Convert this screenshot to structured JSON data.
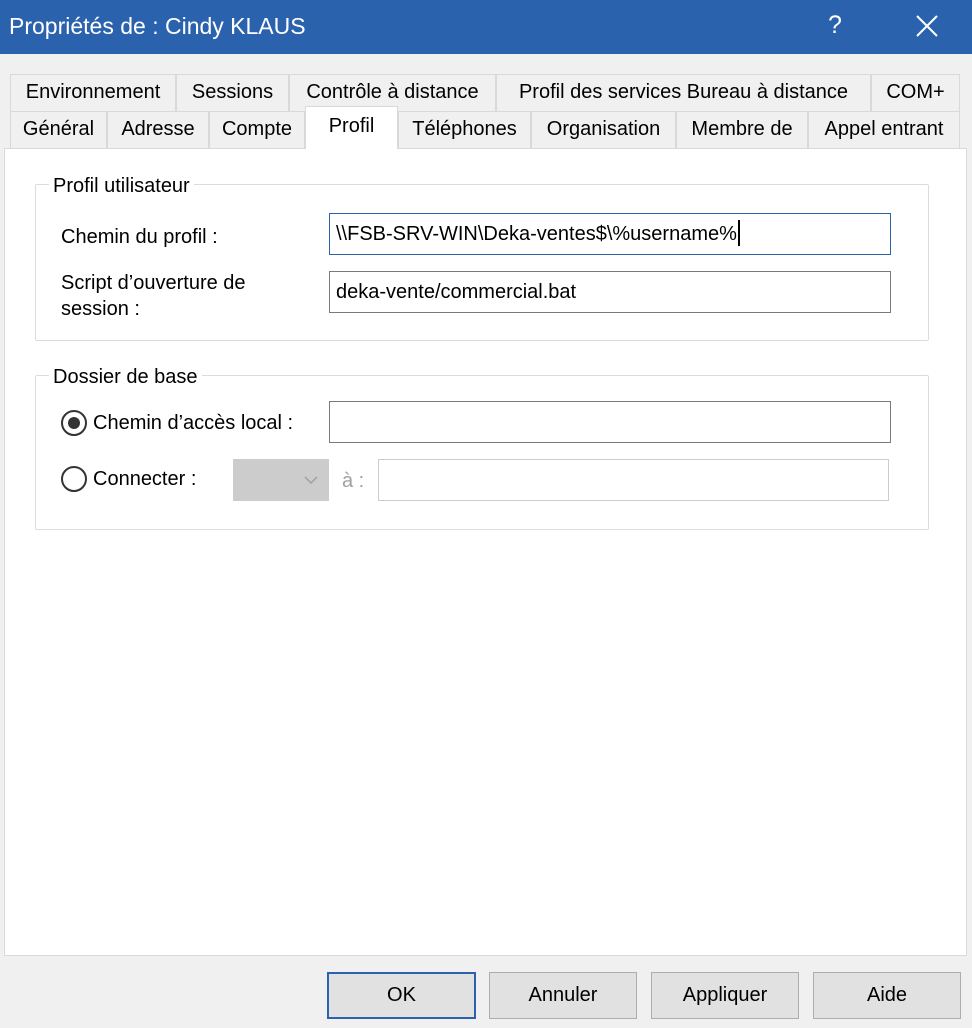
{
  "window": {
    "title": "Propriétés de : Cindy KLAUS",
    "help_label": "?"
  },
  "tabs": {
    "row1": [
      "Environnement",
      "Sessions",
      "Contrôle à distance",
      "Profil des services Bureau à distance",
      "COM+"
    ],
    "row2": [
      "Général",
      "Adresse",
      "Compte",
      "Profil",
      "Téléphones",
      "Organisation",
      "Membre de",
      "Appel entrant"
    ],
    "active": "Profil"
  },
  "profil_utilisateur": {
    "legend": "Profil utilisateur",
    "chemin_label": "Chemin du profil :",
    "chemin_value": "\\\\FSB-SRV-WIN\\Deka-ventes$\\%username%",
    "script_label_line1": "Script d’ouverture de",
    "script_label_line2": "session :",
    "script_value": "deka-vente/commercial.bat"
  },
  "dossier_de_base": {
    "legend": "Dossier de base",
    "local_label": "Chemin d’accès local :",
    "local_value": "",
    "local_selected": true,
    "connecter_label": "Connecter :",
    "connecter_selected": false,
    "drive_value": "",
    "a_label": "à :",
    "remote_value": ""
  },
  "buttons": {
    "ok": "OK",
    "cancel": "Annuler",
    "apply": "Appliquer",
    "help": "Aide"
  },
  "colors": {
    "titlebar": "#2b62ad",
    "accent": "#2b62ad"
  }
}
